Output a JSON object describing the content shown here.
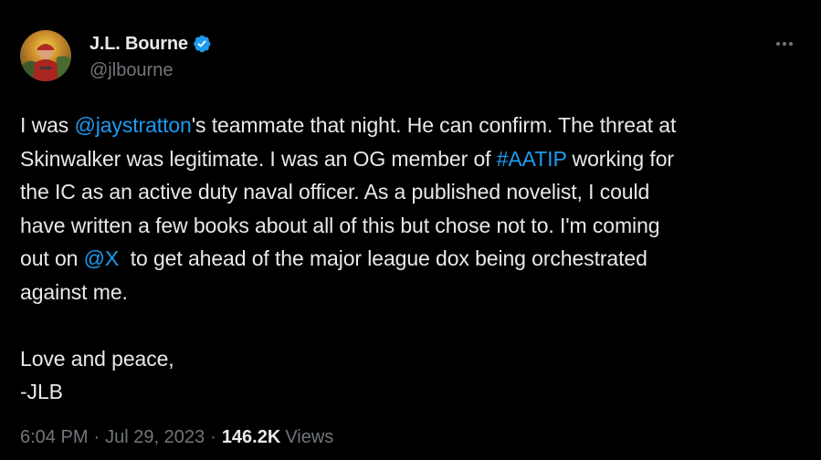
{
  "author": {
    "display_name": "J.L. Bourne",
    "handle": "@jlbourne",
    "verified": true,
    "verified_color": "#1d9bf0"
  },
  "menu_icon": "more-horizontal-icon",
  "tweet": {
    "line1": {
      "pre": "I was ",
      "mention": "@jaystratton",
      "post": "'s teammate that night. He can confirm. The threat at"
    },
    "line2": {
      "pre": "Skinwalker was legitimate. I was an OG member of ",
      "hashtag": "#AATIP",
      "post": " working for"
    },
    "line3": "the IC as an active duty naval officer. As a published novelist, I could",
    "line4": "have written a few books about all of this but chose not to. I'm coming",
    "line5": {
      "pre": "out on ",
      "mention": "@X",
      "post": "  to get ahead of the major league dox being orchestrated"
    },
    "line6": "against me.",
    "line7": "Love and peace,",
    "line8": "-JLB"
  },
  "meta": {
    "time": "6:04 PM",
    "separator": "·",
    "date": "Jul 29, 2023",
    "views_count": "146.2K",
    "views_label": "Views"
  },
  "colors": {
    "background": "#000000",
    "text": "#e7e9ea",
    "secondary": "#71767b",
    "link": "#1d9bf0"
  }
}
